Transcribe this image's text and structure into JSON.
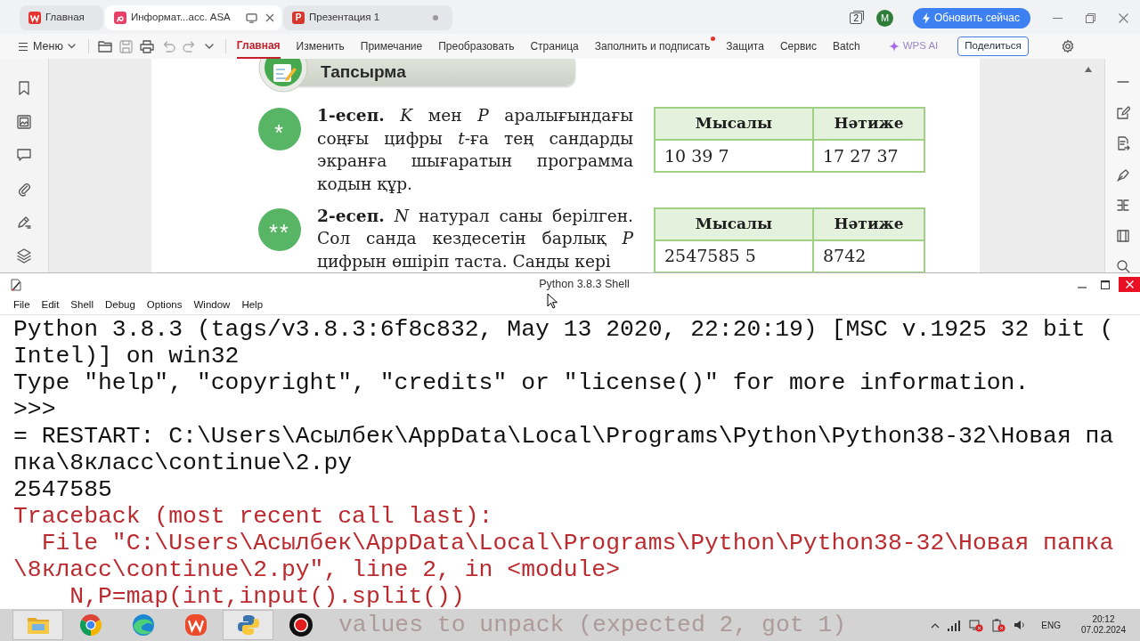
{
  "app_tabs": [
    {
      "kind": "home",
      "label": "Главная",
      "selected": false,
      "unsaved": false
    },
    {
      "kind": "pdf",
      "label": "Информат...асс. ASA",
      "selected": true,
      "unsaved": false
    },
    {
      "kind": "presentation",
      "logo_text": "P",
      "label": "Презентация 1",
      "selected": false,
      "unsaved": true
    }
  ],
  "window_count": "2",
  "account_initial": "M",
  "update_button": "Обновить сейчас",
  "menu_button": "Меню",
  "ribbon_tabs": [
    {
      "label": "Главная",
      "selected": true,
      "notification": false
    },
    {
      "label": "Изменить",
      "selected": false,
      "notification": false
    },
    {
      "label": "Примечание",
      "selected": false,
      "notification": false
    },
    {
      "label": "Преобразовать",
      "selected": false,
      "notification": false
    },
    {
      "label": "Страница",
      "selected": false,
      "notification": false
    },
    {
      "label": "Заполнить и подписать",
      "selected": false,
      "notification": true
    },
    {
      "label": "Защита",
      "selected": false,
      "notification": false
    },
    {
      "label": "Сервис",
      "selected": false,
      "notification": false
    },
    {
      "label": "Batch",
      "selected": false,
      "notification": false
    }
  ],
  "ai_button": "WPS AI",
  "share_button": "Поделиться",
  "document": {
    "banner": "Тапсырма",
    "tasks": [
      {
        "marker": "*",
        "text": "**1-есеп.** *K* мен *P* аралығындағы соңғы цифры *t*-ға тең сандарды экранға шығаратын программа кодын құр.",
        "table": {
          "columns": [
            "Мысалы",
            "Нәтиже"
          ],
          "rows": [
            [
              "10 39 7",
              "17 27 37"
            ]
          ]
        }
      },
      {
        "marker": "**",
        "text": "**2-есеп.** *N* натурал саны берілген. Сол санда кездесетін барлық *P* цифрын өшіріп таста. Санды кері",
        "table": {
          "columns": [
            "Мысалы",
            "Нәтиже"
          ],
          "rows": [
            [
              "2547585 5",
              "8742"
            ]
          ]
        }
      }
    ]
  },
  "shell": {
    "title": "Python 3.8.3 Shell",
    "menu": [
      "File",
      "Edit",
      "Shell",
      "Debug",
      "Options",
      "Window",
      "Help"
    ],
    "lines": [
      {
        "kind": "stdout",
        "text": "Python 3.8.3 (tags/v3.8.3:6f8c832, May 13 2020, 22:20:19) [MSC v.1925 32 bit ("
      },
      {
        "kind": "stdout",
        "text": "Intel)] on win32"
      },
      {
        "kind": "stdout",
        "text": "Type \"help\", \"copyright\", \"credits\" or \"license()\" for more information."
      },
      {
        "kind": "stdout",
        "text": ">>>"
      },
      {
        "kind": "stdout",
        "text": "= RESTART: C:\\Users\\Асылбек\\AppData\\Local\\Programs\\Python\\Python38-32\\Новая па"
      },
      {
        "kind": "stdout",
        "text": "пка\\8класс\\continue\\2.py"
      },
      {
        "kind": "stdout",
        "text": "2547585"
      },
      {
        "kind": "stderr",
        "text": "Traceback (most recent call last):"
      },
      {
        "kind": "stderr",
        "text": "  File \"C:\\Users\\Асылбек\\AppData\\Local\\Programs\\Python\\Python38-32\\Новая папка"
      },
      {
        "kind": "stderr",
        "text": "\\8класс\\continue\\2.py\", line 2, in <module>"
      },
      {
        "kind": "stderr",
        "text": "    N,P=map(int,input().split())"
      },
      {
        "kind": "covered",
        "text": "values to unpack (expected 2, got 1)"
      }
    ]
  },
  "taskbar": {
    "apps": [
      {
        "kind": "explorer",
        "active": true
      },
      {
        "kind": "chrome",
        "active": false
      },
      {
        "kind": "edge",
        "active": false
      },
      {
        "kind": "wps",
        "active": false
      },
      {
        "kind": "python",
        "active": true
      },
      {
        "kind": "recorder",
        "active": false
      }
    ],
    "language": "ENG",
    "time": "20:12",
    "date": "07.02.2024"
  }
}
